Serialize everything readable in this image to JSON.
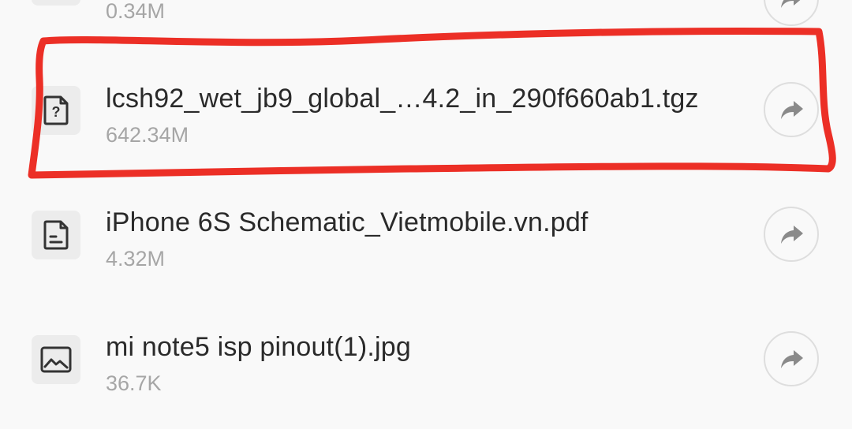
{
  "files": [
    {
      "name": "",
      "size": "0.34M",
      "icon": "document-icon"
    },
    {
      "name": "lcsh92_wet_jb9_global_…4.2_in_290f660ab1.tgz",
      "size": "642.34M",
      "icon": "unknown-file-icon"
    },
    {
      "name": "iPhone 6S Schematic_Vietmobile.vn.pdf",
      "size": "4.32M",
      "icon": "document-icon"
    },
    {
      "name": "mi note5 isp pinout(1).jpg",
      "size": "36.7K",
      "icon": "image-icon"
    }
  ],
  "colors": {
    "background": "#f9f9f9",
    "primary_text": "#2a2a2a",
    "secondary_text": "#a6a6a6",
    "icon_tile": "#ececec",
    "icon_stroke": "#333333",
    "share_icon": "#8a8a8a",
    "annotation": "#ec2f26"
  }
}
